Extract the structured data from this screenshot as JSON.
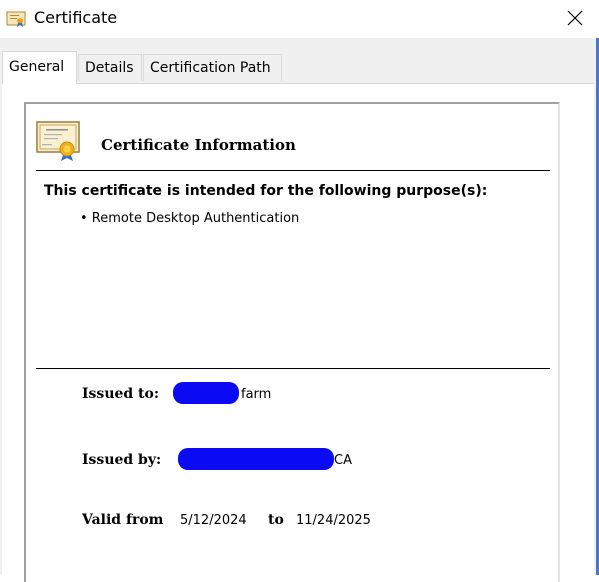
{
  "window": {
    "title": "Certificate",
    "close_glyph": "✕",
    "accent_color": "#4a78c4"
  },
  "tabs": [
    {
      "label": "General",
      "active": true
    },
    {
      "label": "Details",
      "active": false
    },
    {
      "label": "Certification Path",
      "active": false
    }
  ],
  "certificate": {
    "heading": "Certificate Information",
    "purpose_heading": "This certificate is intended for the following purpose(s):",
    "purposes": [
      "• Remote Desktop Authentication"
    ],
    "issued_to_label": "Issued to:",
    "issued_to_value": "farm",
    "issued_by_label": "Issued by:",
    "issued_by_value": "CA",
    "valid_from_label": "Valid from",
    "valid_from": "5/12/2024",
    "to_label": "to",
    "valid_to": "11/24/2025",
    "redaction_color": "#0a0af5"
  }
}
